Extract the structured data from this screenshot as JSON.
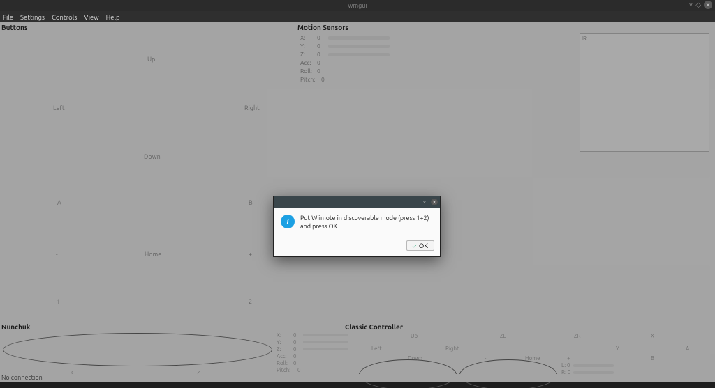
{
  "window": {
    "title": "wmgui"
  },
  "menubar": {
    "file": "File",
    "settings": "Settings",
    "controls": "Controls",
    "view": "View",
    "help": "Help"
  },
  "buttons_panel": {
    "title": "Buttons",
    "up": "Up",
    "left": "Left",
    "right": "Right",
    "down": "Down",
    "a": "A",
    "b": "B",
    "minus": "-",
    "home": "Home",
    "plus": "+",
    "one": "1",
    "two": "2"
  },
  "motion_panel": {
    "title": "Motion Sensors",
    "rows": [
      {
        "label": "X:",
        "value": "0"
      },
      {
        "label": "Y:",
        "value": "0"
      },
      {
        "label": "Z:",
        "value": "0"
      },
      {
        "label": "Acc:",
        "value": "0"
      },
      {
        "label": "Roll:",
        "value": "0"
      },
      {
        "label": "Pitch:",
        "value": "0"
      }
    ],
    "ir_label": "IR"
  },
  "nunchuk_panel": {
    "title": "Nunchuk",
    "c": "C",
    "z": "Z",
    "rows": [
      {
        "label": "X:",
        "value": "0"
      },
      {
        "label": "Y:",
        "value": "0"
      },
      {
        "label": "Z:",
        "value": "0"
      },
      {
        "label": "Acc:",
        "value": "0"
      },
      {
        "label": "Roll:",
        "value": "0"
      },
      {
        "label": "Pitch:",
        "value": "0"
      }
    ]
  },
  "classic_panel": {
    "title": "Classic Controller",
    "up": "Up",
    "left": "Left",
    "right": "Right",
    "down": "Down",
    "minus": "-",
    "home": "Home",
    "plus": "+",
    "zl": "ZL",
    "zr": "ZR",
    "x": "X",
    "y": "Y",
    "a": "A",
    "b": "B",
    "l_label": "L: 0",
    "r_label": "R: 0"
  },
  "statusbar": {
    "text": "No connection"
  },
  "dialog": {
    "message": "Put Wiimote in discoverable mode (press 1+2) and press OK",
    "ok": "OK"
  }
}
